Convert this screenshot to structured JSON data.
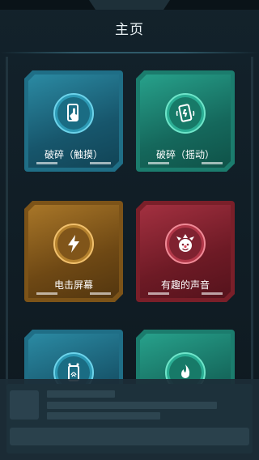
{
  "header": {
    "title": "主页"
  },
  "cards": [
    {
      "label": "破碎（触摸）",
      "icon": "touch-phone-icon"
    },
    {
      "label": "破碎（摇动）",
      "icon": "shake-phone-icon"
    },
    {
      "label": "电击屏幕",
      "icon": "lightning-icon"
    },
    {
      "label": "有趣的声音",
      "icon": "clown-icon"
    },
    {
      "label": "",
      "icon": "fingerprint-phone-icon"
    },
    {
      "label": "",
      "icon": "flame-icon"
    }
  ],
  "colors": {
    "background": "#0f1b22",
    "blue": "#1f6e86",
    "green": "#1b7c6d",
    "orange": "#7c5318",
    "red": "#7a1f29"
  }
}
